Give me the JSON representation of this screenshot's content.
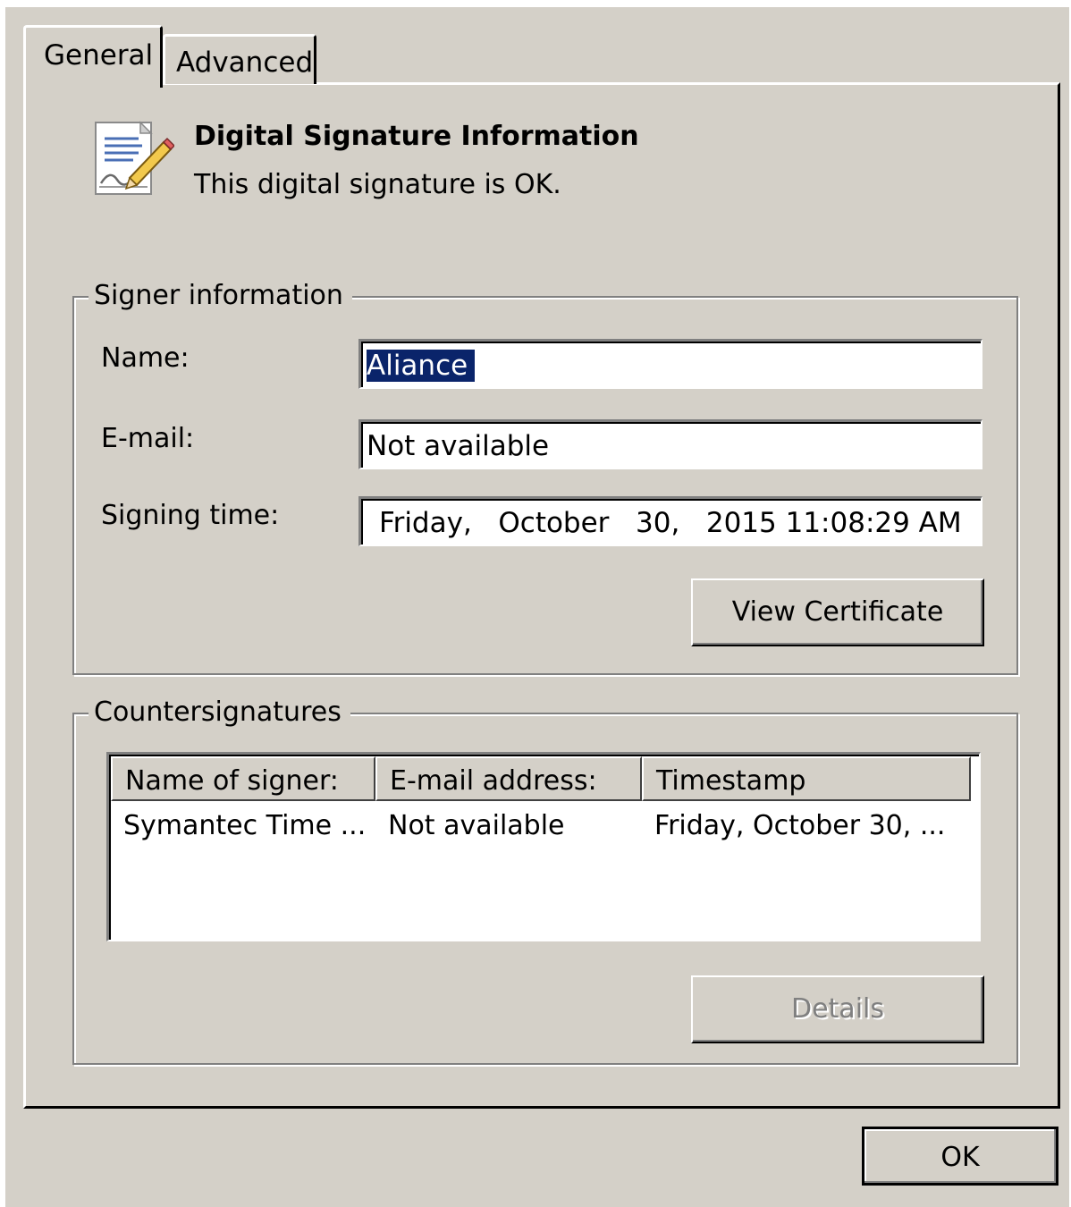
{
  "tabs": [
    {
      "label": "General"
    },
    {
      "label": "Advanced"
    }
  ],
  "header": {
    "title": "Digital Signature Information",
    "status": "This digital signature is OK.",
    "icon": "certificate-icon"
  },
  "signer": {
    "legend": "Signer information",
    "name_label": "Name:",
    "name_value": "Aliance",
    "email_label": "E-mail:",
    "email_value": "Not available",
    "time_label": "Signing time:",
    "time_value": "Friday,   October   30,   2015 11:08:29 AM",
    "view_certificate": "View Certificate"
  },
  "countersignatures": {
    "legend": "Countersignatures",
    "columns": [
      "Name of signer:",
      "E-mail address:",
      "Timestamp"
    ],
    "rows": [
      [
        "Symantec Time ...",
        "Not available",
        "Friday, October 30, ..."
      ]
    ],
    "details": "Details"
  },
  "ok_label": "OK",
  "colors": {
    "face": "#d4d0c8",
    "selection": "#0a246a"
  }
}
